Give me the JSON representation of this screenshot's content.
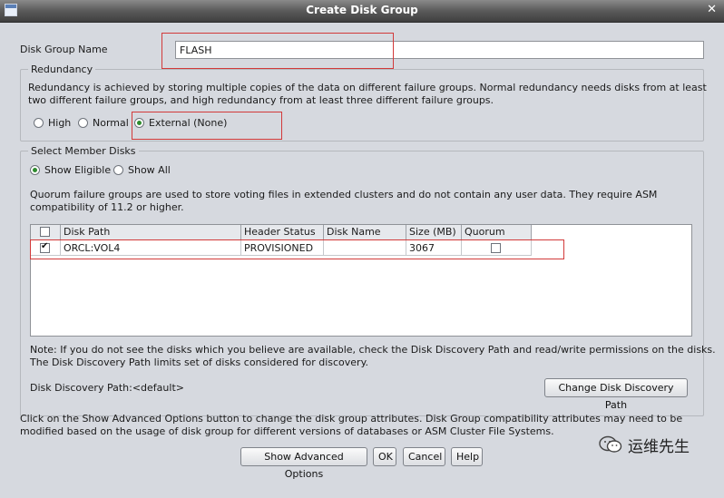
{
  "window": {
    "title": "Create Disk Group"
  },
  "disk_group_name": {
    "label": "Disk Group Name",
    "value": "FLASH"
  },
  "redundancy": {
    "legend": "Redundancy",
    "description_line1": "Redundancy is achieved by storing multiple copies of the data on different failure groups. Normal redundancy needs disks from at least",
    "description_line2": "two different failure groups, and high redundancy from at least three different failure groups.",
    "options": [
      {
        "label": "High",
        "selected": false
      },
      {
        "label": "Normal",
        "selected": false
      },
      {
        "label": "External (None)",
        "selected": true
      }
    ]
  },
  "member_disks": {
    "legend": "Select Member Disks",
    "show_options": [
      {
        "label": "Show Eligible",
        "selected": true
      },
      {
        "label": "Show All",
        "selected": false
      }
    ],
    "quorum_note_line1": "Quorum failure groups are used to store voting files in extended clusters and do not contain any user data. They require ASM",
    "quorum_note_line2": "compatibility of 11.2 or higher.",
    "table": {
      "columns": [
        "",
        "Disk Path",
        "Header Status",
        "Disk Name",
        "Size (MB)",
        "Quorum"
      ],
      "rows": [
        {
          "selected": true,
          "disk_path": "ORCL:VOL4",
          "header_status": "PROVISIONED",
          "disk_name": "",
          "size_mb": "3067",
          "quorum": false
        }
      ]
    },
    "discovery_note_line1": "Note: If you do not see the disks which you believe are available, check the Disk Discovery Path and read/write permissions on the disks.",
    "discovery_note_line2": "The Disk Discovery Path limits set of disks considered for discovery.",
    "discovery_path_label": "Disk Discovery Path:<default>",
    "change_path_button": "Change Disk Discovery Path"
  },
  "footer": {
    "note_line1": "Click on the Show Advanced Options button to change the disk group attributes. Disk Group compatibility attributes may need to be",
    "note_line2": "modified based on the usage of disk group for different versions of databases or ASM Cluster File Systems.",
    "buttons": {
      "advanced": "Show Advanced Options",
      "ok": "OK",
      "cancel": "Cancel",
      "help": "Help"
    }
  },
  "watermark": {
    "text": "运维先生"
  },
  "colors": {
    "highlight_box": "#d23a3a",
    "radio_selected": "#2e8b2e"
  }
}
